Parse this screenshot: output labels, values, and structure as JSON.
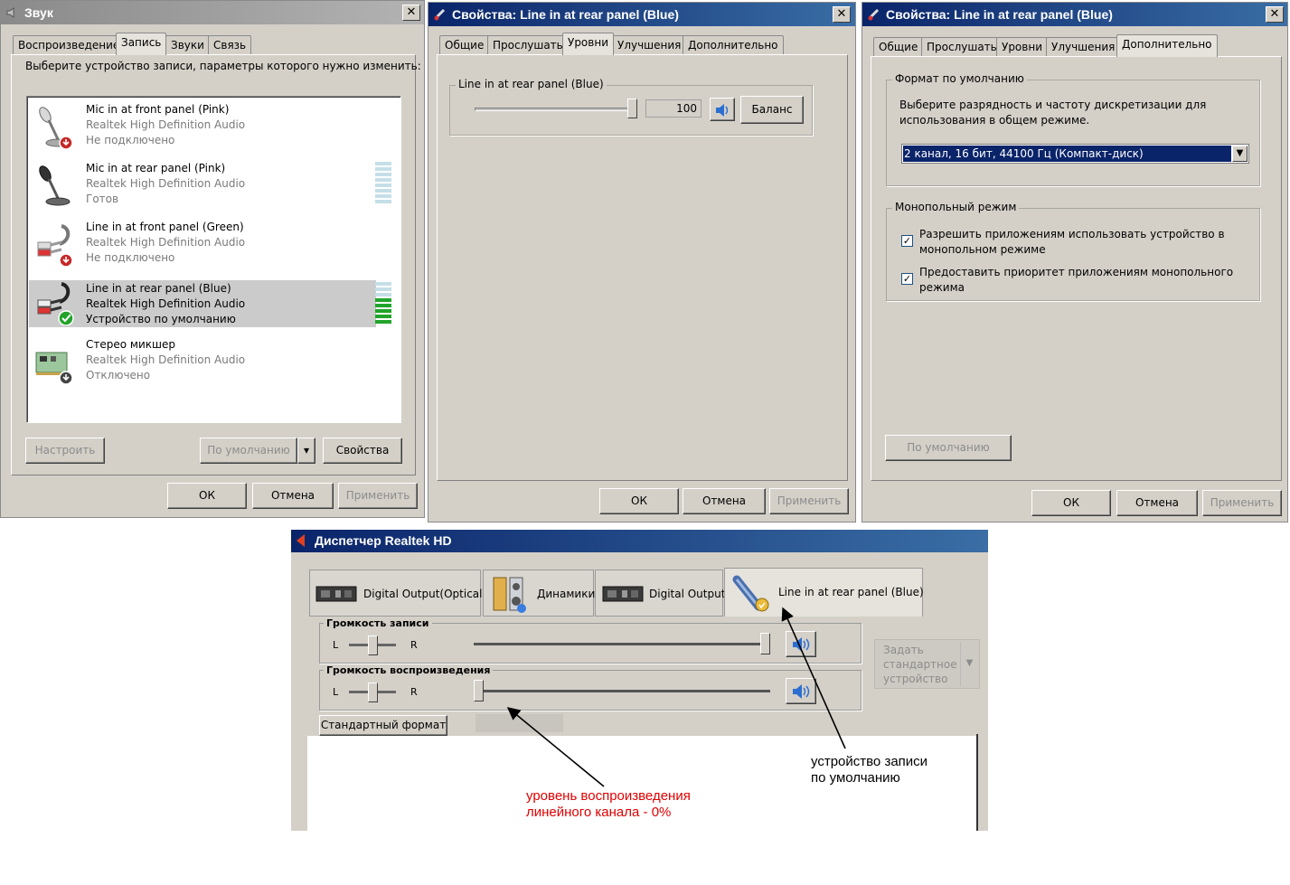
{
  "sound_window": {
    "title": "Звук",
    "tabs": [
      "Воспроизведение",
      "Запись",
      "Звуки",
      "Связь"
    ],
    "instruction": "Выберите устройство записи, параметры которого нужно изменить:",
    "devices": [
      {
        "name": "Mic in at front panel (Pink)",
        "driver": "Realtek High Definition Audio",
        "status": "Не подключено",
        "icon": "microphone-icon"
      },
      {
        "name": "Mic in at rear panel (Pink)",
        "driver": "Realtek High Definition Audio",
        "status": "Готов",
        "icon": "microphone-icon"
      },
      {
        "name": "Line in at front panel (Green)",
        "driver": "Realtek High Definition Audio",
        "status": "Не подключено",
        "icon": "rca-cable-icon"
      },
      {
        "name": "Line in at rear panel (Blue)",
        "driver": "Realtek High Definition Audio",
        "status": "Устройство по умолчанию",
        "icon": "rca-cable-icon"
      },
      {
        "name": "Стерео микшер",
        "driver": "Realtek High Definition Audio",
        "status": "Отключено",
        "icon": "sound-card-icon"
      }
    ],
    "buttons": {
      "configure": "Настроить",
      "set_default": "По умолчанию",
      "properties": "Свойства",
      "ok": "ОК",
      "cancel": "Отмена",
      "apply": "Применить"
    }
  },
  "props_levels": {
    "title": "Свойства: Line in at rear panel (Blue)",
    "tabs": [
      "Общие",
      "Прослушать",
      "Уровни",
      "Улучшения",
      "Дополнительно"
    ],
    "group_label": "Line in at rear panel (Blue)",
    "level_value": "100",
    "level_fraction": 1.0,
    "balance_button": "Баланс",
    "buttons": {
      "ok": "ОК",
      "cancel": "Отмена",
      "apply": "Применить"
    }
  },
  "props_advanced": {
    "title": "Свойства: Line in at rear panel (Blue)",
    "tabs": [
      "Общие",
      "Прослушать",
      "Уровни",
      "Улучшения",
      "Дополнительно"
    ],
    "format_group": "Формат по умолчанию",
    "format_hint_1": "Выберите разрядность и частоту дискретизации для",
    "format_hint_2": "использования в общем режиме.",
    "format_value": "2 канал, 16 бит, 44100 Гц (Компакт-диск)",
    "exclusive_group": "Монопольный режим",
    "exclusive_opt1_line1": "Разрешить приложениям использовать устройство в",
    "exclusive_opt1_line2": "монопольном режиме",
    "exclusive_opt2_line1": "Предоставить приоритет приложениям монопольного",
    "exclusive_opt2_line2": "режима",
    "restore_default": "По умолчанию",
    "buttons": {
      "ok": "ОК",
      "cancel": "Отмена",
      "apply": "Применить"
    }
  },
  "realtek": {
    "title": "Диспетчер Realtek HD",
    "tabs": [
      {
        "label": "Digital Output(Optical)",
        "icon": "digital-output-icon"
      },
      {
        "label": "Динамики",
        "icon": "speakers-icon"
      },
      {
        "label": "Digital Output",
        "icon": "digital-output-icon"
      },
      {
        "label": "Line in at rear panel (Blue)",
        "icon": "line-in-icon"
      }
    ],
    "record_group": "Громкость записи",
    "playback_group": "Громкость воспроизведения",
    "left": "L",
    "right": "R",
    "record_volume_fraction": 1.0,
    "playback_volume_fraction": 0.0,
    "set_default_device": [
      "Задать",
      "стандартное",
      "устройство"
    ],
    "standard_format": "Стандартный формат"
  },
  "annotations": {
    "default_device_1": "устройство записи",
    "default_device_2": "по умолчанию",
    "playback_level_1": "уровень воспроизведения",
    "playback_level_2": "линейного канала -  0%",
    "playback_level_color": "#e00000"
  }
}
